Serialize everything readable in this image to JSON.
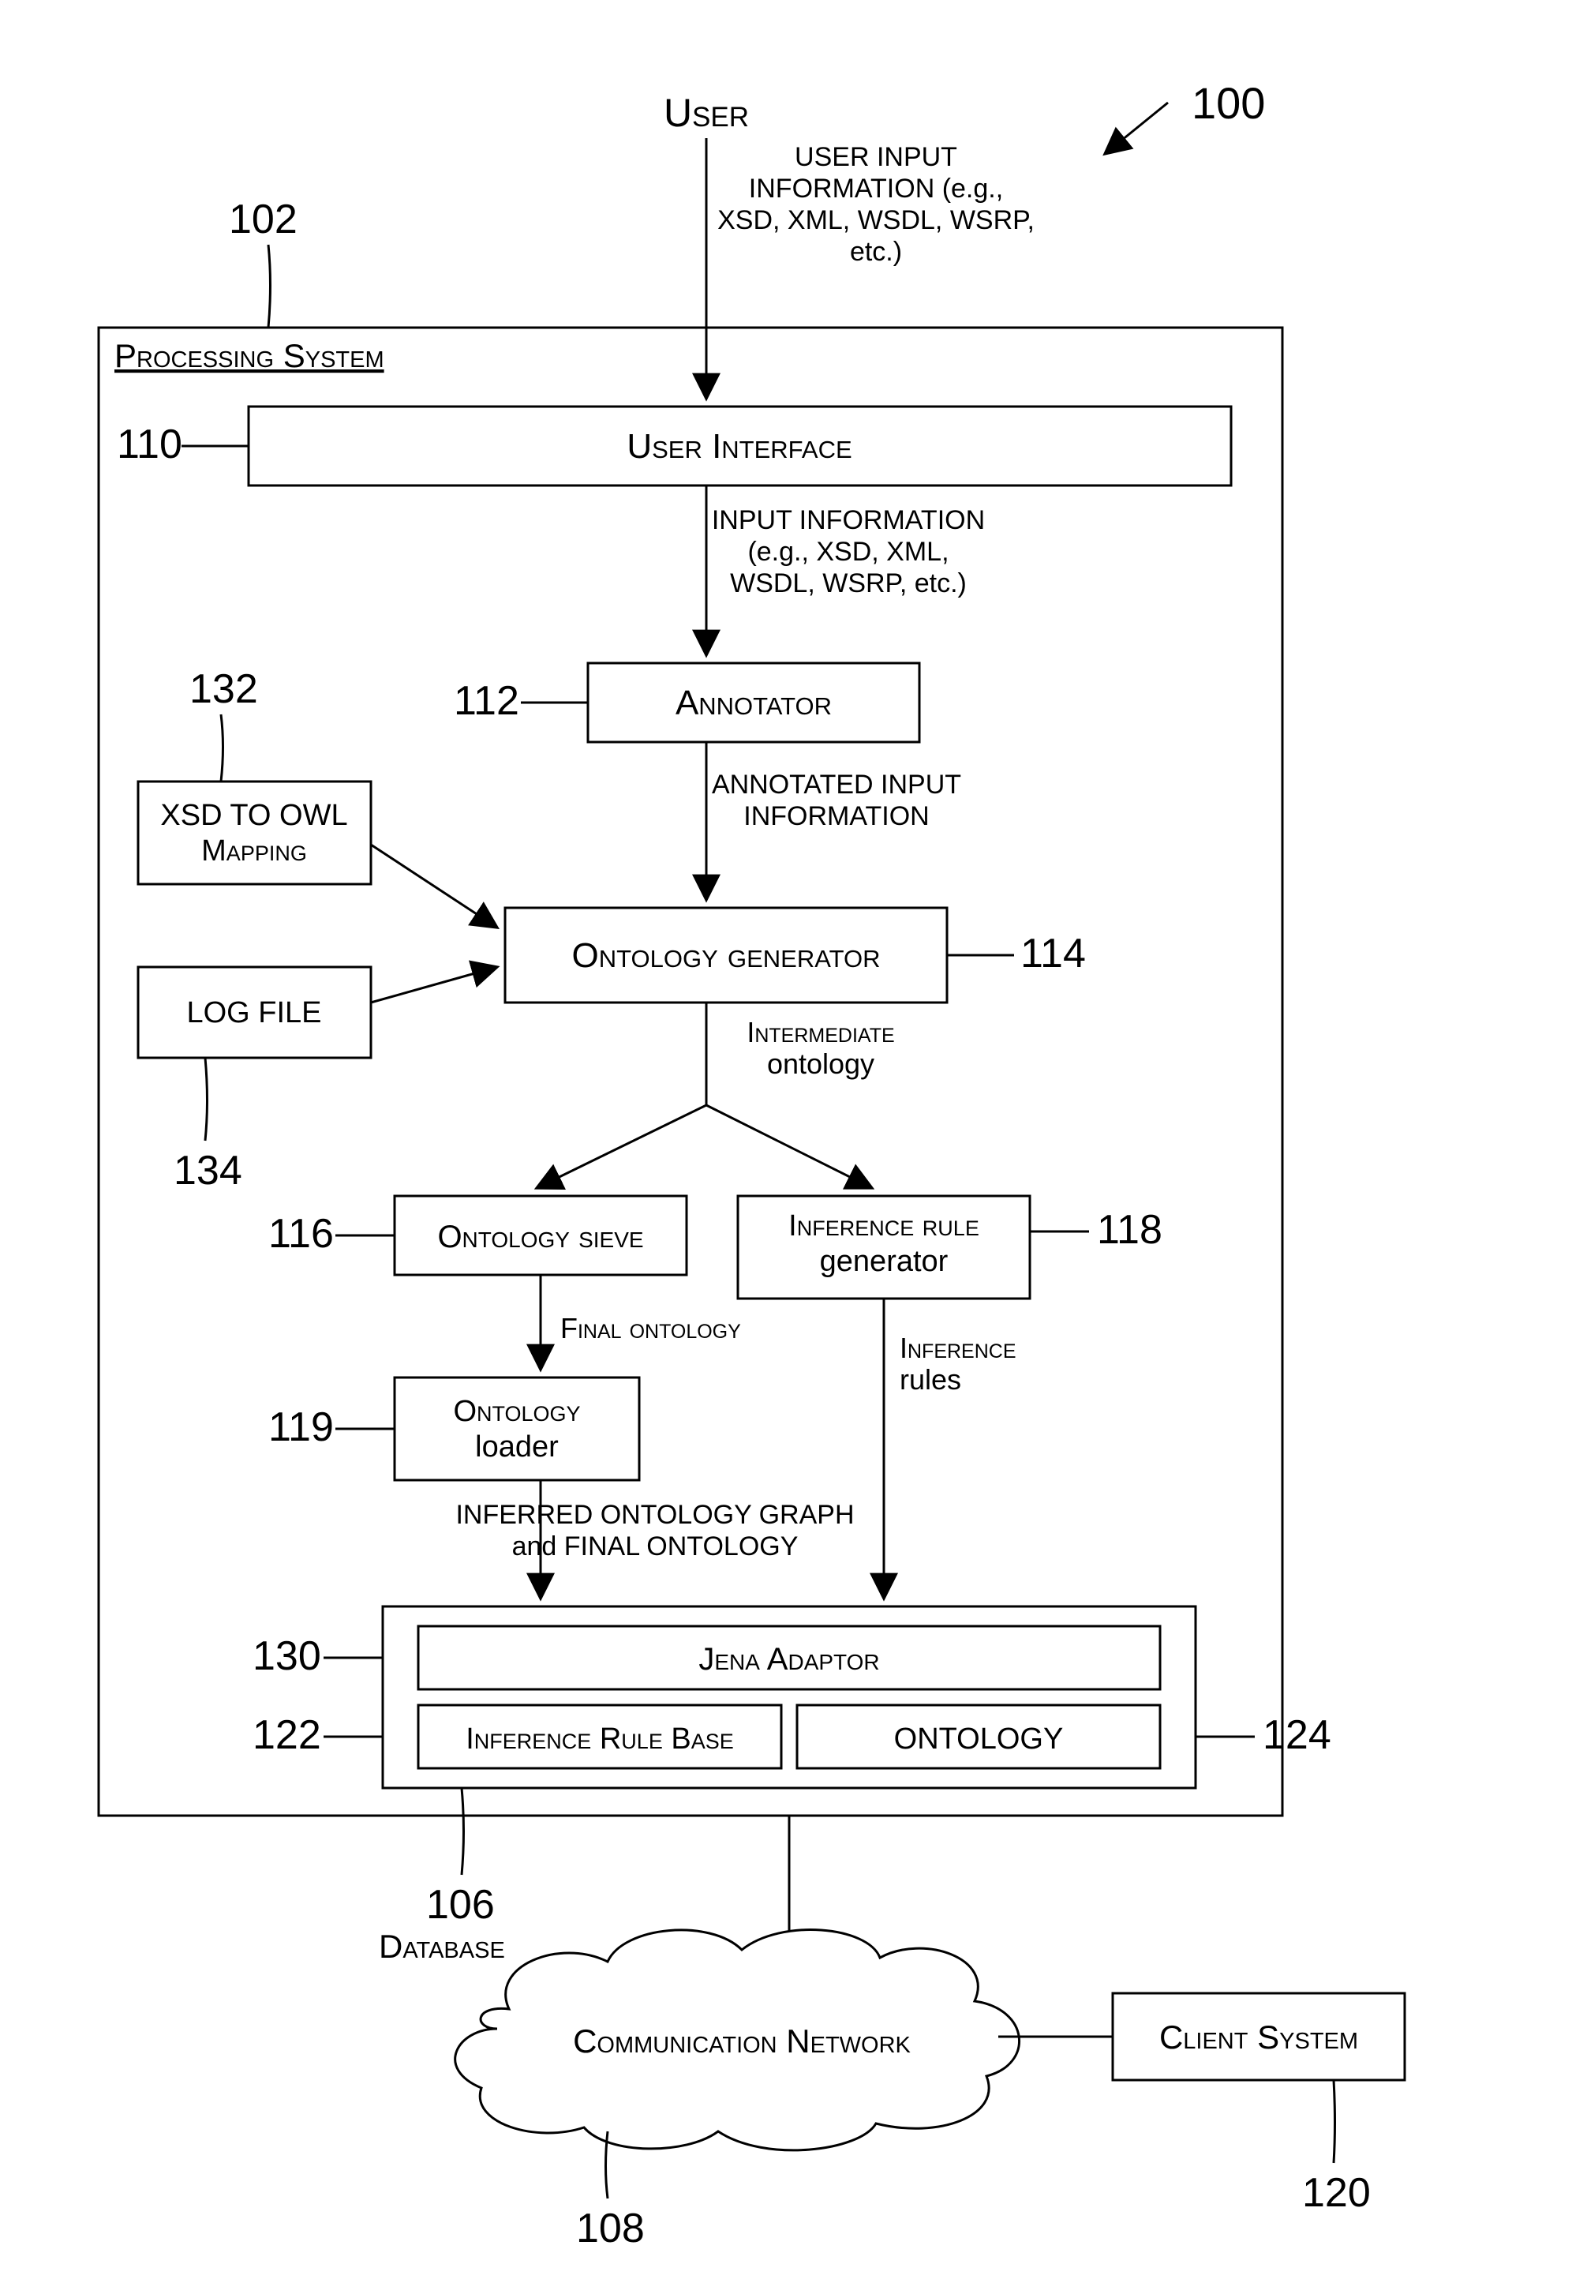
{
  "figure_ref": "100",
  "user_label": "User",
  "user_input_note_l1": "USER INPUT",
  "user_input_note_l2": "INFORMATION (e.g.,",
  "user_input_note_l3": "XSD, XML, WSDL, WSRP,",
  "user_input_note_l4": "etc.)",
  "processing_system": {
    "ref": "102",
    "label": "Processing System"
  },
  "user_interface": {
    "ref": "110",
    "label": "User Interface"
  },
  "input_info_note_l1": "INPUT INFORMATION",
  "input_info_note_l2": "(e.g., XSD, XML,",
  "input_info_note_l3": "WSDL, WSRP, etc.)",
  "annotator": {
    "ref": "112",
    "label": "Annotator"
  },
  "annotated_note_l1": "ANNOTATED INPUT",
  "annotated_note_l2": "INFORMATION",
  "xsd_owl": {
    "ref": "132",
    "label_l1": "XSD TO OWL",
    "label_l2": "Mapping"
  },
  "log_file": {
    "ref": "134",
    "label": "LOG FILE"
  },
  "ontology_generator": {
    "ref": "114",
    "label": "Ontology generator"
  },
  "intermediate_note_l1": "Intermediate",
  "intermediate_note_l2": "ontology",
  "ontology_sieve": {
    "ref": "116",
    "label": "Ontology sieve"
  },
  "inference_rule_generator": {
    "ref": "118",
    "label_l1": "Inference rule",
    "label_l2": "generator"
  },
  "final_ontology_note": "Final ontology",
  "inference_rules_note_l1": "Inference",
  "inference_rules_note_l2": "rules",
  "ontology_loader": {
    "ref": "119",
    "label_l1": "Ontology",
    "label_l2": "loader"
  },
  "inferred_note_l1": "INFERRED ONTOLOGY GRAPH",
  "inferred_note_l2": "and FINAL ONTOLOGY",
  "jena_adaptor": {
    "ref": "130",
    "label": "Jena Adaptor"
  },
  "inference_rule_base": {
    "ref": "122",
    "label": "Inference Rule Base"
  },
  "ontology_store": {
    "ref": "124",
    "label": "ONTOLOGY"
  },
  "database": {
    "ref": "106",
    "label": "Database"
  },
  "communication_network": {
    "ref": "108",
    "label": "Communication Network"
  },
  "client_system": {
    "ref": "120",
    "label": "Client System"
  }
}
